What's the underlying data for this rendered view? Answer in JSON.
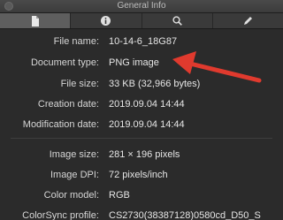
{
  "window": {
    "title": "General Info"
  },
  "tabs": [
    {
      "icon": "document-icon",
      "active": true
    },
    {
      "icon": "info-icon",
      "active": false
    },
    {
      "icon": "search-icon",
      "active": false
    },
    {
      "icon": "pencil-icon",
      "active": false
    }
  ],
  "file_info": [
    {
      "label": "File name:",
      "value": "10-14-6_18G87"
    },
    {
      "label": "Document type:",
      "value": "PNG image"
    },
    {
      "label": "File size:",
      "value": "33 KB (32,966 bytes)"
    },
    {
      "label": "Creation date:",
      "value": "2019.09.04 14:44"
    },
    {
      "label": "Modification date:",
      "value": "2019.09.04 14:44"
    }
  ],
  "image_info": [
    {
      "label": "Image size:",
      "value": "281 × 196 pixels"
    },
    {
      "label": "Image DPI:",
      "value": "72 pixels/inch"
    },
    {
      "label": "Color model:",
      "value": "RGB"
    },
    {
      "label": "ColorSync profile:",
      "value": "CS2730(38387128)0580cd_D50_S"
    }
  ],
  "annotation": {
    "color": "#e03a2e"
  }
}
